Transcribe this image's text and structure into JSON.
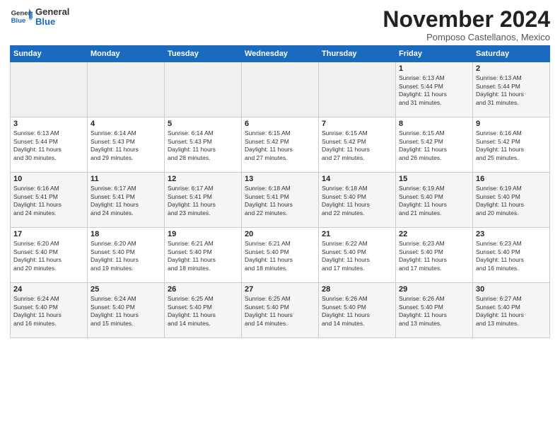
{
  "logo": {
    "general": "General",
    "blue": "Blue"
  },
  "title": "November 2024",
  "location": "Pomposo Castellanos, Mexico",
  "days_of_week": [
    "Sunday",
    "Monday",
    "Tuesday",
    "Wednesday",
    "Thursday",
    "Friday",
    "Saturday"
  ],
  "weeks": [
    [
      {
        "day": "",
        "info": ""
      },
      {
        "day": "",
        "info": ""
      },
      {
        "day": "",
        "info": ""
      },
      {
        "day": "",
        "info": ""
      },
      {
        "day": "",
        "info": ""
      },
      {
        "day": "1",
        "info": "Sunrise: 6:13 AM\nSunset: 5:44 PM\nDaylight: 11 hours\nand 31 minutes."
      },
      {
        "day": "2",
        "info": "Sunrise: 6:13 AM\nSunset: 5:44 PM\nDaylight: 11 hours\nand 31 minutes."
      }
    ],
    [
      {
        "day": "3",
        "info": "Sunrise: 6:13 AM\nSunset: 5:44 PM\nDaylight: 11 hours\nand 30 minutes."
      },
      {
        "day": "4",
        "info": "Sunrise: 6:14 AM\nSunset: 5:43 PM\nDaylight: 11 hours\nand 29 minutes."
      },
      {
        "day": "5",
        "info": "Sunrise: 6:14 AM\nSunset: 5:43 PM\nDaylight: 11 hours\nand 28 minutes."
      },
      {
        "day": "6",
        "info": "Sunrise: 6:15 AM\nSunset: 5:42 PM\nDaylight: 11 hours\nand 27 minutes."
      },
      {
        "day": "7",
        "info": "Sunrise: 6:15 AM\nSunset: 5:42 PM\nDaylight: 11 hours\nand 27 minutes."
      },
      {
        "day": "8",
        "info": "Sunrise: 6:15 AM\nSunset: 5:42 PM\nDaylight: 11 hours\nand 26 minutes."
      },
      {
        "day": "9",
        "info": "Sunrise: 6:16 AM\nSunset: 5:42 PM\nDaylight: 11 hours\nand 25 minutes."
      }
    ],
    [
      {
        "day": "10",
        "info": "Sunrise: 6:16 AM\nSunset: 5:41 PM\nDaylight: 11 hours\nand 24 minutes."
      },
      {
        "day": "11",
        "info": "Sunrise: 6:17 AM\nSunset: 5:41 PM\nDaylight: 11 hours\nand 24 minutes."
      },
      {
        "day": "12",
        "info": "Sunrise: 6:17 AM\nSunset: 5:41 PM\nDaylight: 11 hours\nand 23 minutes."
      },
      {
        "day": "13",
        "info": "Sunrise: 6:18 AM\nSunset: 5:41 PM\nDaylight: 11 hours\nand 22 minutes."
      },
      {
        "day": "14",
        "info": "Sunrise: 6:18 AM\nSunset: 5:40 PM\nDaylight: 11 hours\nand 22 minutes."
      },
      {
        "day": "15",
        "info": "Sunrise: 6:19 AM\nSunset: 5:40 PM\nDaylight: 11 hours\nand 21 minutes."
      },
      {
        "day": "16",
        "info": "Sunrise: 6:19 AM\nSunset: 5:40 PM\nDaylight: 11 hours\nand 20 minutes."
      }
    ],
    [
      {
        "day": "17",
        "info": "Sunrise: 6:20 AM\nSunset: 5:40 PM\nDaylight: 11 hours\nand 20 minutes."
      },
      {
        "day": "18",
        "info": "Sunrise: 6:20 AM\nSunset: 5:40 PM\nDaylight: 11 hours\nand 19 minutes."
      },
      {
        "day": "19",
        "info": "Sunrise: 6:21 AM\nSunset: 5:40 PM\nDaylight: 11 hours\nand 18 minutes."
      },
      {
        "day": "20",
        "info": "Sunrise: 6:21 AM\nSunset: 5:40 PM\nDaylight: 11 hours\nand 18 minutes."
      },
      {
        "day": "21",
        "info": "Sunrise: 6:22 AM\nSunset: 5:40 PM\nDaylight: 11 hours\nand 17 minutes."
      },
      {
        "day": "22",
        "info": "Sunrise: 6:23 AM\nSunset: 5:40 PM\nDaylight: 11 hours\nand 17 minutes."
      },
      {
        "day": "23",
        "info": "Sunrise: 6:23 AM\nSunset: 5:40 PM\nDaylight: 11 hours\nand 16 minutes."
      }
    ],
    [
      {
        "day": "24",
        "info": "Sunrise: 6:24 AM\nSunset: 5:40 PM\nDaylight: 11 hours\nand 16 minutes."
      },
      {
        "day": "25",
        "info": "Sunrise: 6:24 AM\nSunset: 5:40 PM\nDaylight: 11 hours\nand 15 minutes."
      },
      {
        "day": "26",
        "info": "Sunrise: 6:25 AM\nSunset: 5:40 PM\nDaylight: 11 hours\nand 14 minutes."
      },
      {
        "day": "27",
        "info": "Sunrise: 6:25 AM\nSunset: 5:40 PM\nDaylight: 11 hours\nand 14 minutes."
      },
      {
        "day": "28",
        "info": "Sunrise: 6:26 AM\nSunset: 5:40 PM\nDaylight: 11 hours\nand 14 minutes."
      },
      {
        "day": "29",
        "info": "Sunrise: 6:26 AM\nSunset: 5:40 PM\nDaylight: 11 hours\nand 13 minutes."
      },
      {
        "day": "30",
        "info": "Sunrise: 6:27 AM\nSunset: 5:40 PM\nDaylight: 11 hours\nand 13 minutes."
      }
    ]
  ]
}
